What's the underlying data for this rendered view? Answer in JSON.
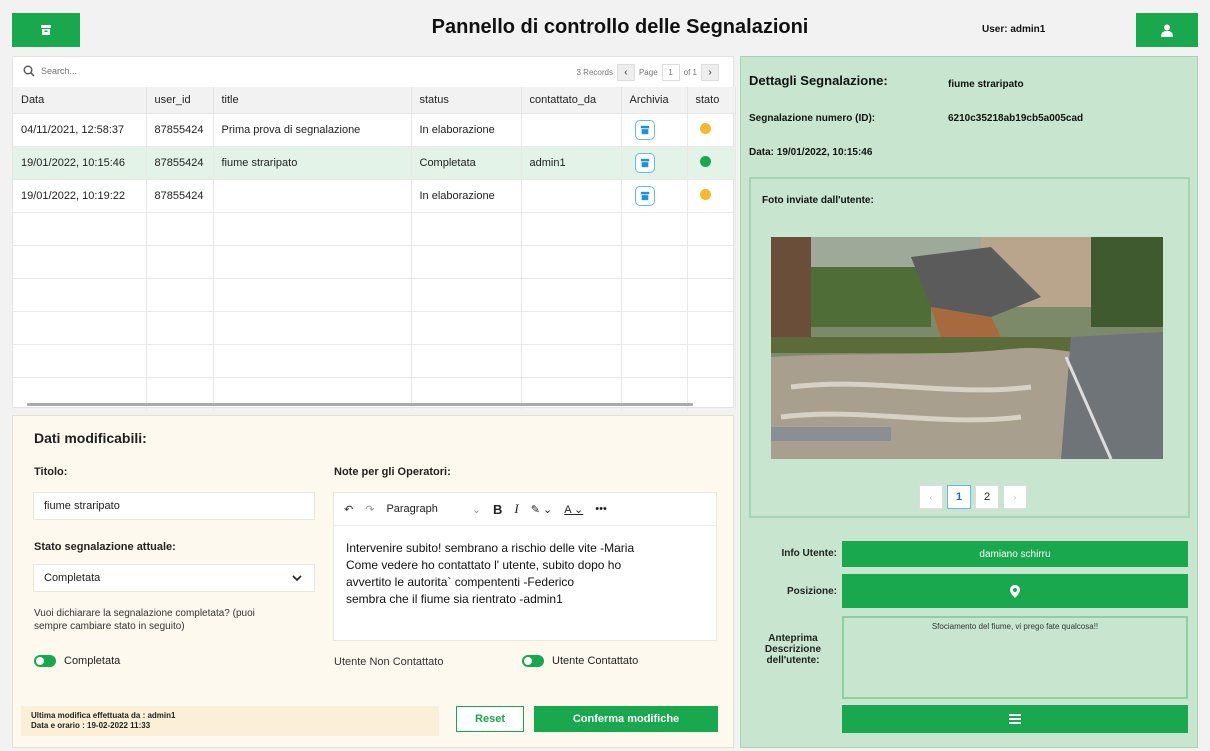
{
  "header": {
    "title": "Pannello di controllo delle Segnalazioni",
    "user_label": "User: admin1",
    "left_button_icon": "archive-box-icon",
    "right_button_icon": "user-icon"
  },
  "table": {
    "search_placeholder": "Search...",
    "records": "3 Records",
    "page_label": "Page",
    "page_value": "1",
    "page_of": "of 1",
    "columns": [
      "Data",
      "user_id",
      "title",
      "status",
      "contattato_da",
      "Archivia",
      "stato"
    ],
    "rows": [
      {
        "data": "04/11/2021, 12:58:37",
        "user_id": "87855424",
        "title": "Prima prova di segnalazione",
        "status": "In elaborazione",
        "contattato_da": "",
        "stato_color": "#f7b731"
      },
      {
        "data": "19/01/2022, 10:15:46",
        "user_id": "87855424",
        "title": "fiume straripato",
        "status": "Completata",
        "contattato_da": "admin1",
        "stato_color": "#1aa84f"
      },
      {
        "data": "19/01/2022, 10:19:22",
        "user_id": "87855424",
        "title": "",
        "status": "In elaborazione",
        "contattato_da": "",
        "stato_color": "#f7b731"
      }
    ]
  },
  "edit": {
    "heading": "Dati modificabili:",
    "titolo_label": "Titolo:",
    "titolo_value": "fiume straripato",
    "stato_label": "Stato segnalazione attuale:",
    "stato_value": "Completata",
    "question_line1": "Vuoi dichiarare la segnalazione completata? (puoi",
    "question_line2": "sempre cambiare stato in seguito)",
    "toggle_completata": "Completata",
    "note_label": "Note per gli Operatori:",
    "editor_block": "Paragraph",
    "note_lines": [
      "Intervenire subito! sembrano a rischio delle vite -Maria",
      "Come vedere ho contattato l' utente, subito dopo ho",
      "avvertito le autorita` compententi -Federico",
      "sembra che il fiume sia rientrato -admin1"
    ],
    "utente_non_contattato": "Utente Non Contattato",
    "utente_contattato": "Utente Contattato",
    "last_mod_line1": "Ultima modifica effettuata da : admin1",
    "last_mod_line2": "Data e orario : 19-02-2022 11:33",
    "reset": "Reset",
    "confirm": "Conferma modifiche"
  },
  "details": {
    "heading": "Dettagli Segnalazione:",
    "title_value": "fiume straripato",
    "id_label": "Segnalazione numero (ID):",
    "id_value": "6210c35218ab19cb5a005cad",
    "date_label": "Data: 19/01/2022, 10:15:46",
    "photos_label": "Foto inviate dall'utente:",
    "pages": [
      "1",
      "2"
    ],
    "info_label": "Info Utente:",
    "info_value": "damiano schirru",
    "position_label": "Posizione:",
    "preview_label_1": "Anteprima",
    "preview_label_2": "Descrizione",
    "preview_label_3": "dell'utente:",
    "description": "Sfociamento del fiume, vi prego fate qualcosa!!"
  },
  "colors": {
    "accent": "#1aa84f",
    "panel_green": "#c8e6cf",
    "panel_cream": "#fdf9ef",
    "in_progress": "#f7b731"
  }
}
